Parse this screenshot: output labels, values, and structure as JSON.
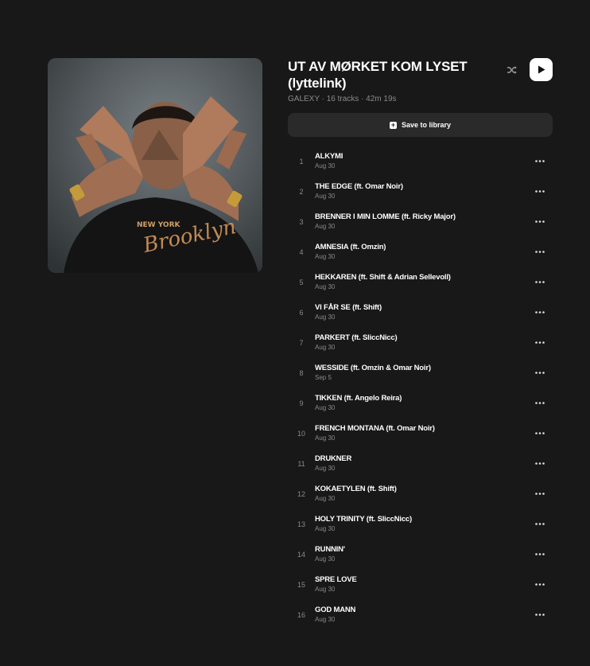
{
  "album": {
    "title": "UT AV MØRKET KOM LYSET (lyttelink)",
    "meta": "GALEXY · 16 tracks · 42m 19s"
  },
  "actions": {
    "save_label": "Save to library",
    "shuffle_icon": "shuffle-icon",
    "play_icon": "play-icon"
  },
  "colors": {
    "background": "#181818",
    "surface": "#2a2a2a",
    "muted_text": "#8a8a8a"
  },
  "tracks": [
    {
      "num": "1",
      "name": "ALKYMI",
      "date": "Aug 30"
    },
    {
      "num": "2",
      "name": "THE EDGE (ft. Omar Noir)",
      "date": "Aug 30"
    },
    {
      "num": "3",
      "name": "BRENNER I MIN LOMME (ft. Ricky Major)",
      "date": "Aug 30"
    },
    {
      "num": "4",
      "name": "AMNESIA (ft. Omzin)",
      "date": "Aug 30"
    },
    {
      "num": "5",
      "name": "HEKKAREN (ft. Shift & Adrian Sellevoll)",
      "date": "Aug 30"
    },
    {
      "num": "6",
      "name": "VI FÅR SE (ft. Shift)",
      "date": "Aug 30"
    },
    {
      "num": "7",
      "name": "PARKERT (ft. SliccNicc)",
      "date": "Aug 30"
    },
    {
      "num": "8",
      "name": "WESSIDE (ft. Omzin & Omar Noir)",
      "date": "Sep 5"
    },
    {
      "num": "9",
      "name": "TIKKEN (ft. Angelo Reira)",
      "date": "Aug 30"
    },
    {
      "num": "10",
      "name": "FRENCH MONTANA (ft. Omar Noir)",
      "date": "Aug 30"
    },
    {
      "num": "11",
      "name": "DRUKNER",
      "date": "Aug 30"
    },
    {
      "num": "12",
      "name": "KOKAETYLEN (ft. Shift)",
      "date": "Aug 30"
    },
    {
      "num": "13",
      "name": "HOLY TRINITY (ft. SliccNicc)",
      "date": "Aug 30"
    },
    {
      "num": "14",
      "name": "RUNNIN'",
      "date": "Aug 30"
    },
    {
      "num": "15",
      "name": "SPRE LOVE",
      "date": "Aug 30"
    },
    {
      "num": "16",
      "name": "GOD MANN",
      "date": "Aug 30"
    }
  ]
}
